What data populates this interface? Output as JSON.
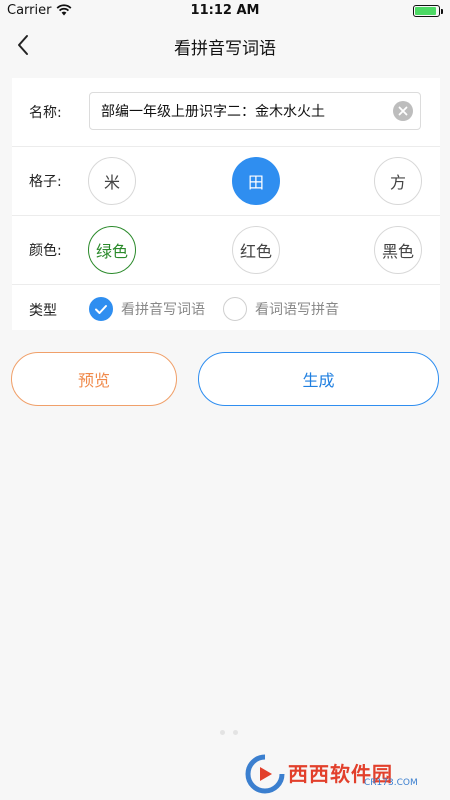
{
  "status_bar": {
    "carrier": "Carrier",
    "time": "11:12 AM",
    "battery_level": 0.9
  },
  "nav": {
    "title": "看拼音写词语",
    "back_icon": "chevron-left-icon"
  },
  "form": {
    "name": {
      "label": "名称:",
      "value": "部编一年级上册识字二：金木水火土",
      "clear_icon": "clear-circle-icon"
    },
    "grid": {
      "label": "格子:",
      "options": [
        "米",
        "田",
        "方"
      ],
      "selected": "田"
    },
    "color": {
      "label": "颜色:",
      "options": [
        "绿色",
        "红色",
        "黑色"
      ],
      "selected": "绿色",
      "selected_color": "#2b8a2b"
    },
    "type": {
      "label": "类型",
      "options": [
        "看拼音写词语",
        "看词语写拼音"
      ],
      "selected": "看拼音写词语"
    }
  },
  "buttons": {
    "preview": "预览",
    "generate": "生成"
  },
  "colors": {
    "accent_blue": "#2f8ef0",
    "preview_orange": "#f08a4b",
    "background": "#f7f7f7"
  },
  "watermark": {
    "text": "西西软件园",
    "url_text": "CR173.COM"
  }
}
